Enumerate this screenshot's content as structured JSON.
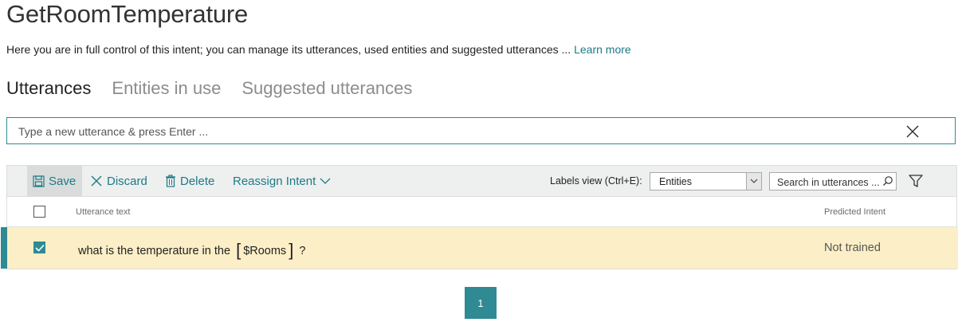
{
  "page": {
    "title": "GetRoomTemperature",
    "subtitle": "Here you are in full control of this intent; you can manage its utterances, used entities and suggested utterances ...",
    "learn_more": "Learn more"
  },
  "tabs": [
    {
      "label": "Utterances",
      "active": true
    },
    {
      "label": "Entities in use",
      "active": false
    },
    {
      "label": "Suggested utterances",
      "active": false
    }
  ],
  "utterance_input": {
    "placeholder": "Type a new utterance & press Enter ...",
    "value": ""
  },
  "toolbar": {
    "save_label": "Save",
    "discard_label": "Discard",
    "delete_label": "Delete",
    "reassign_label": "Reassign Intent",
    "labels_view_label": "Labels view (Ctrl+E):",
    "labels_view_selected": "Entities",
    "search_placeholder": "Search in utterances ..."
  },
  "table": {
    "columns": {
      "utterance": "Utterance text",
      "intent": "Predicted Intent"
    },
    "rows": [
      {
        "checked": true,
        "text_before": "what is the temperature in the",
        "bracket_open": "[",
        "entity": "$Rooms",
        "bracket_close": "]",
        "text_after": "?",
        "predicted_intent": "Not trained"
      }
    ]
  },
  "pagination": {
    "current_page": "1"
  },
  "colors": {
    "accent": "#2f8a94",
    "link": "#1d7a86",
    "row_highlight": "#fcefc7",
    "toolbar_bg": "#eeefef"
  }
}
